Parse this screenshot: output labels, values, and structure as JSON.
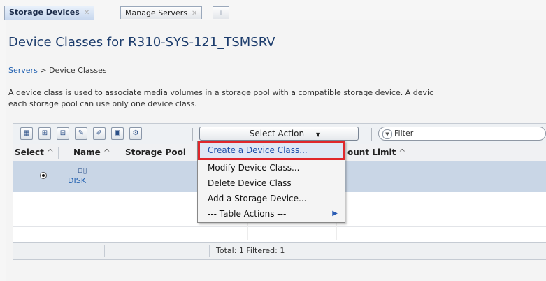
{
  "tabs": [
    {
      "label": "Storage Devices",
      "active": true
    },
    {
      "label": "Manage Servers",
      "active": false
    }
  ],
  "page_title": "Device Classes for R310-SYS-121_TSMSRV",
  "breadcrumb": {
    "link": "Servers",
    "separator": ">",
    "current": "Device Classes"
  },
  "description": "A device class is used to associate media volumes in a storage pool with a compatible storage device. A devic\neach storage pool can use only one device class.",
  "toolbar": {
    "select_action": "--- Select Action ---",
    "filter_placeholder": "Filter"
  },
  "table": {
    "columns": [
      "Select",
      "Name",
      "Storage Pool",
      "Mount Limit"
    ],
    "columns_visible_text": {
      "select": "Select",
      "name": "Name",
      "storage_pool": "Storage Pool",
      "mount_limit_fragment": "ount Limit"
    },
    "rows": [
      {
        "name": "DISK",
        "selected": true
      }
    ],
    "footer": "Total: 1   Filtered: 1"
  },
  "menu": {
    "items": [
      {
        "label": "Create a Device Class...",
        "highlighted": true
      },
      {
        "label": "Modify Device Class..."
      },
      {
        "label": "Delete Device Class"
      },
      {
        "label": "Add a Storage Device..."
      },
      {
        "label": "--- Table Actions ---",
        "submenu": true
      }
    ]
  },
  "colors": {
    "title": "#1c3c6c",
    "link": "#1f5fb0",
    "row_selected": "#c9d6e6",
    "highlight_box": "#e0262b"
  },
  "icons": [
    "table-view-icon",
    "expand-icon",
    "collapse-icon",
    "edit-icon",
    "edit-sort-icon",
    "select-all-icon",
    "configure-icon",
    "filter-dropdown-icon",
    "device-icon",
    "submenu-arrow-icon"
  ]
}
